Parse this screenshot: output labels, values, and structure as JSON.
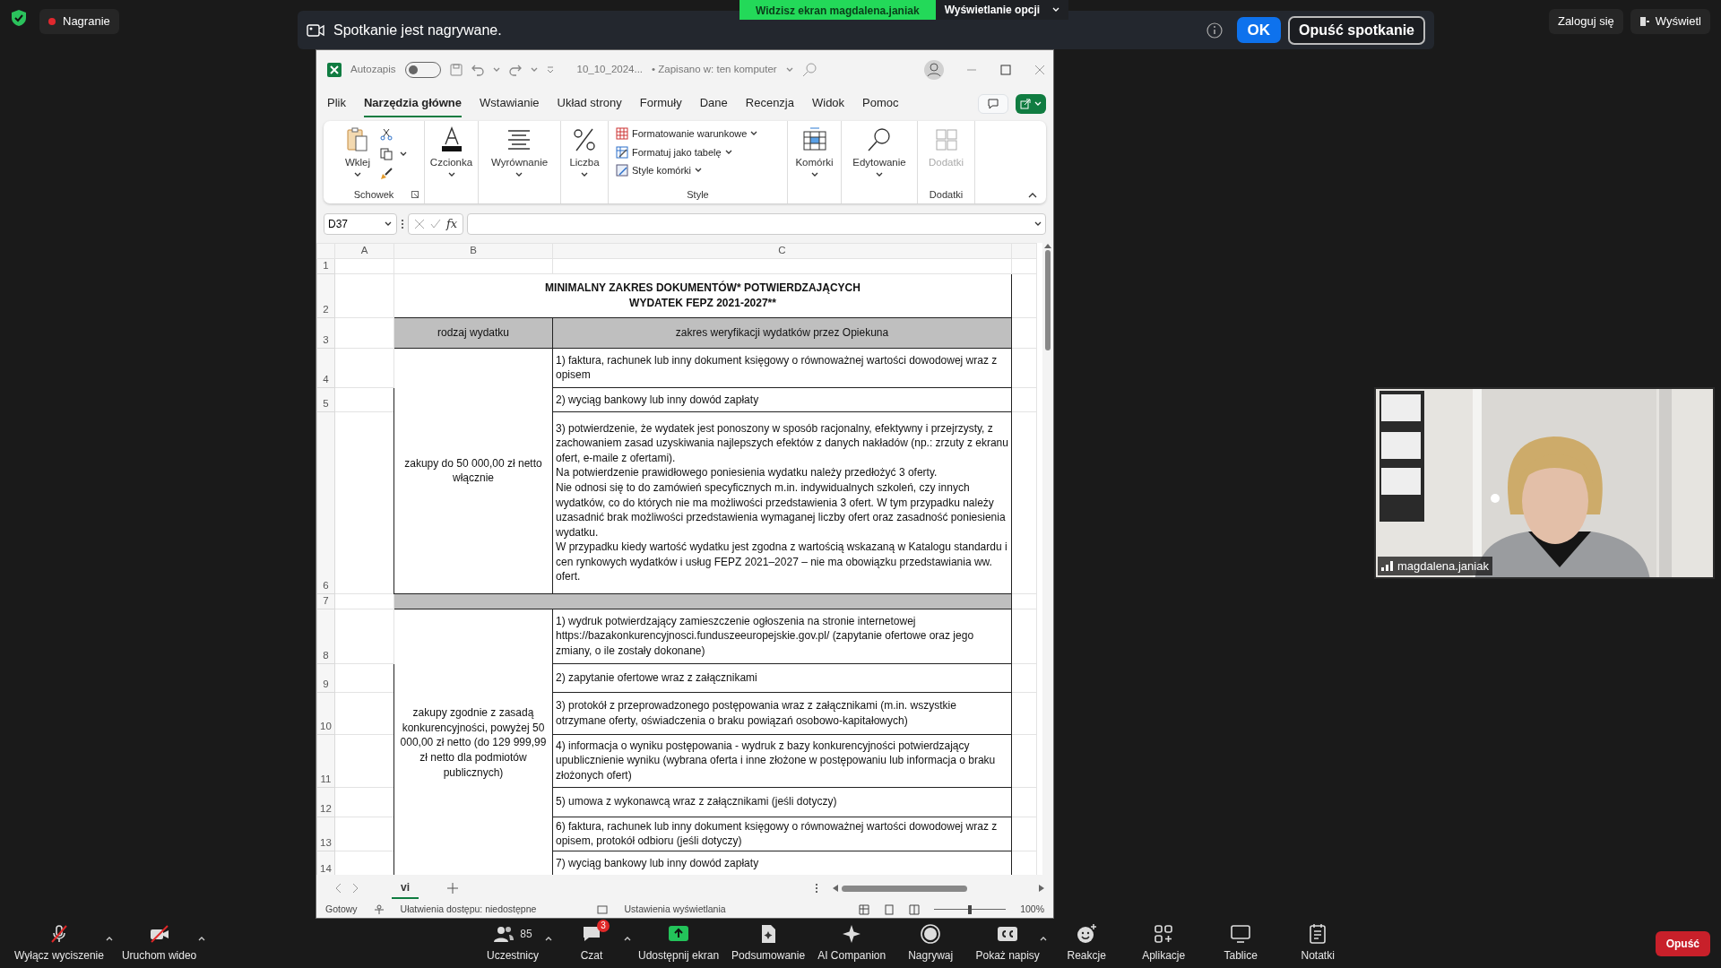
{
  "top_bar": {
    "recording": "Nagranie",
    "buttons": [
      "Zaloguj się",
      "Wyświetl"
    ]
  },
  "notification": {
    "text": "Spotkanie jest nagrywane.",
    "ok": "OK",
    "leave": "Opuść spotkanie"
  },
  "share_banner": {
    "label": "Widzisz ekran magdalena.janiak",
    "options": "Wyświetlanie opcji"
  },
  "excel": {
    "autosave": {
      "label": "Autozapis",
      "on": false
    },
    "filename": "10_10_2024...",
    "save_status": "• Zapisano w: ten komputer",
    "tabs": [
      {
        "label": "Plik",
        "selected": false
      },
      {
        "label": "Narzędzia główne",
        "selected": true
      },
      {
        "label": "Wstawianie",
        "selected": false
      },
      {
        "label": "Układ strony",
        "selected": false
      },
      {
        "label": "Formuły",
        "selected": false
      },
      {
        "label": "Dane",
        "selected": false
      },
      {
        "label": "Recenzja",
        "selected": false
      },
      {
        "label": "Widok",
        "selected": false
      },
      {
        "label": "Pomoc",
        "selected": false
      }
    ],
    "ribbon_groups": [
      {
        "kind": "clipboard",
        "label": "Schowek",
        "button": "Wklej"
      },
      {
        "kind": "font",
        "button": "Czcionka"
      },
      {
        "kind": "align",
        "button": "Wyrównanie"
      },
      {
        "kind": "number",
        "button": "Liczba"
      },
      {
        "kind": "styles",
        "label": "Style",
        "items": [
          "Formatowanie warunkowe",
          "Formatuj jako tabelę",
          "Style komórki"
        ]
      },
      {
        "kind": "cells",
        "button": "Komórki"
      },
      {
        "kind": "find",
        "button": "Edytowanie"
      },
      {
        "kind": "addins",
        "label": "Dodatki",
        "button": "Dodatki",
        "disabled": true
      }
    ],
    "name_box": "D37",
    "formula_button": "fx",
    "columns": [
      "A",
      "B",
      "C"
    ],
    "row_numbers": [
      "1",
      "2",
      "3",
      "4",
      "5",
      "6",
      "7",
      "8",
      "9",
      "10",
      "11",
      "12",
      "13",
      "14"
    ],
    "title_lines": [
      "MINIMALNY ZAKRES DOKUMENTÓW* POTWIERDZAJĄCYCH",
      "WYDATEK FEPZ 2021-2027**"
    ],
    "headers": [
      "rodzaj wydatku",
      "zakres weryfikacji wydatków przez Opiekuna"
    ],
    "sections": [
      {
        "category": "zakupy do 50 000,00 zł netto włącznie",
        "items": [
          "1) faktura, rachunek lub inny dokument księgowy o równoważnej wartości dowodowej wraz z opisem",
          "2) wyciąg bankowy lub inny dowód zapłaty",
          "3) potwierdzenie, że wydatek jest ponoszony w sposób racjonalny, efektywny i przejrzysty, z zachowaniem zasad uzyskiwania najlepszych efektów z danych nakładów (np.: zrzuty z ekranu ofert, e-maile z ofertami).\nNa potwierdzenie prawidłowego poniesienia wydatku należy przedłożyć 3 oferty.\nNie odnosi się to do zamówień specyficznych m.in. indywidualnych szkoleń, czy innych wydatków, co do których nie ma możliwości przedstawienia 3 ofert. W tym przypadku należy uzasadnić brak możliwości przedstawienia wymaganej liczby ofert oraz zasadność poniesienia wydatku.\nW przypadku kiedy wartość wydatku jest zgodna z wartością wskazaną w Katalogu standardu i cen rynkowych wydatków i usług FEPZ 2021–2027 – nie ma obowiązku przedstawiania ww. ofert."
        ]
      },
      {
        "category": "zakupy zgodnie z zasadą konkurencyjności, powyżej 50 000,00 zł netto (do 129 999,99 zł netto dla podmiotów publicznych)",
        "items": [
          "1) wydruk potwierdzający zamieszczenie ogłoszenia na stronie internetowej https://bazakonkurencyjnosci.funduszeeuropejskie.gov.pl/ (zapytanie ofertowe oraz jego zmiany, o ile zostały dokonane)",
          "2) zapytanie ofertowe wraz z załącznikami",
          "3) protokół z przeprowadzonego postępowania wraz z załącznikami (m.in. wszystkie otrzymane oferty, oświadczenia o braku powiązań osobowo-kapitałowych)",
          "4) informacja o wyniku postępowania - wydruk z bazy konkurencyjności potwierdzający upublicznienie wyniku (wybrana oferta i inne złożone w postępowaniu lub informacja o braku złożonych ofert)",
          "5) umowa z wykonawcą wraz z załącznikami (jeśli dotyczy)",
          "6) faktura, rachunek lub inny dokument księgowy o równoważnej wartości dowodowej wraz z opisem, protokół odbioru (jeśli dotyczy)",
          "7) wyciąg bankowy lub inny dowód zapłaty"
        ]
      }
    ],
    "sheet_tabs": [
      {
        "label": "vi",
        "selected": true
      }
    ],
    "status": [
      "Gotowy",
      "Ułatwienia dostępu: niedostępne",
      "Ustawienia wyświetlania"
    ],
    "zoom": {
      "level": 0.5,
      "reading": "100%"
    }
  },
  "video": {
    "kind": "picture",
    "name": "magdalena.janiak"
  },
  "toolbar": [
    {
      "kind": "mic",
      "label": "Wyłącz wyciszenie",
      "menu": true
    },
    {
      "kind": "video",
      "label": "Uruchom wideo",
      "menu": true
    },
    {
      "kind": "people",
      "label": "Uczestnicy",
      "count": "85",
      "menu": true
    },
    {
      "kind": "chat",
      "label": "Czat",
      "badge": "3",
      "menu": true
    },
    {
      "kind": "share",
      "label": "Udostępnij ekran",
      "menu": false
    },
    {
      "kind": "summary",
      "label": "Podsumowanie",
      "menu": false
    },
    {
      "kind": "ai",
      "label": "AI Companion",
      "menu": false
    },
    {
      "kind": "record",
      "label": "Nagrywaj",
      "menu": false
    },
    {
      "kind": "cc",
      "label": "Pokaż napisy",
      "menu": true
    },
    {
      "kind": "react",
      "label": "Reakcje",
      "menu": false
    },
    {
      "kind": "apps",
      "label": "Aplikacje",
      "menu": false
    },
    {
      "kind": "board",
      "label": "Tablice",
      "menu": false
    },
    {
      "kind": "notes",
      "label": "Notatki",
      "menu": false
    }
  ],
  "leave_button": "Opuść"
}
